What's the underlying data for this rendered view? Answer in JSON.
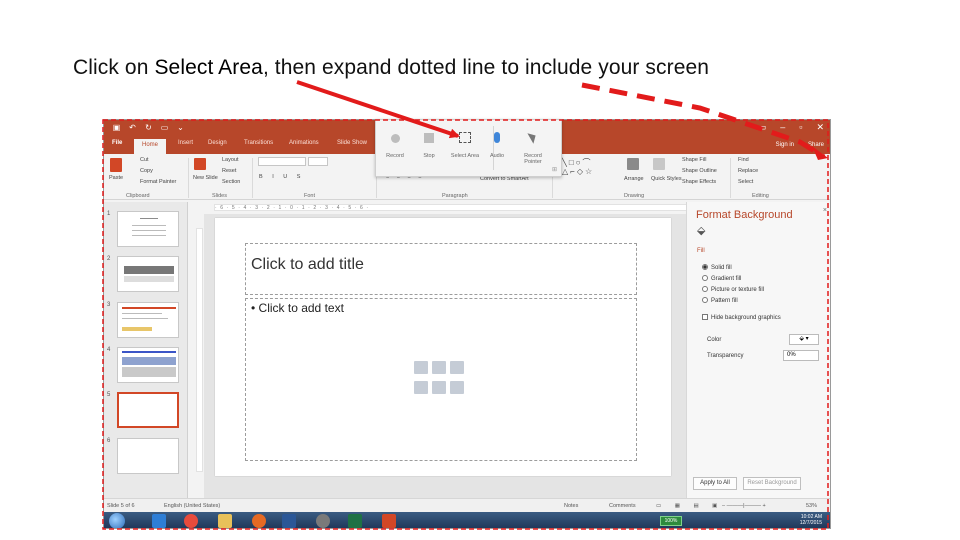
{
  "instruction": {
    "prefix": "Click on ",
    "target": "Select Area",
    "suffix": ",  then expand dotted line to include your screen"
  },
  "ppt": {
    "tabs": [
      "File",
      "Home",
      "Insert",
      "Design",
      "Transitions",
      "Animations",
      "Slide Show"
    ],
    "sign_in": "Sign in",
    "share": "Share",
    "ribbon": {
      "paste": "Paste",
      "cut": "Cut",
      "copy": "Copy",
      "format_painter": "Format Painter",
      "new_slide": "New Slide",
      "layout": "Layout",
      "reset": "Reset",
      "section": "Section",
      "convert_smartart": "Convert to SmartArt",
      "arrange": "Arrange",
      "quick_styles": "Quick Styles",
      "shape_fill": "Shape Fill",
      "shape_outline": "Shape Outline",
      "shape_effects": "Shape Effects",
      "find": "Find",
      "replace": "Replace",
      "select": "Select",
      "groups": [
        "Clipboard",
        "Slides",
        "Font",
        "Paragraph",
        "Drawing",
        "Editing"
      ]
    },
    "slide_numbers": [
      "1",
      "2",
      "3",
      "4",
      "5",
      "6"
    ],
    "slide": {
      "title_placeholder": "Click to add title",
      "body_placeholder": "• Click to add text"
    },
    "format_pane": {
      "title": "Format Background",
      "close": "×",
      "section": "Fill",
      "options": [
        "Solid fill",
        "Gradient fill",
        "Picture or texture fill",
        "Pattern fill"
      ],
      "selected_option": 0,
      "hide_graphics": "Hide background graphics",
      "color_label": "Color",
      "transparency_label": "Transparency",
      "transparency_value": "0%",
      "apply_all": "Apply to All",
      "reset_background": "Reset Background"
    },
    "status": {
      "slide_of": "Slide 5 of 6",
      "language": "English (United States)",
      "notes": "Notes",
      "comments": "Comments",
      "zoom": "53%"
    },
    "taskbar": {
      "time": "10:02 AM",
      "date": "12/7/2015",
      "indicator": "100%"
    }
  },
  "recorder": {
    "items": [
      {
        "label": "Record",
        "icon": "record-icon"
      },
      {
        "label": "Stop",
        "icon": "stop-icon"
      },
      {
        "label": "Select Area",
        "icon": "select-area-icon"
      },
      {
        "label": "Audio",
        "icon": "microphone-icon"
      },
      {
        "label": "Record Pointer",
        "icon": "pointer-icon"
      }
    ],
    "pin": "⊞"
  },
  "colors": {
    "accent": "#b7472a",
    "annotation": "#e21b1b"
  }
}
